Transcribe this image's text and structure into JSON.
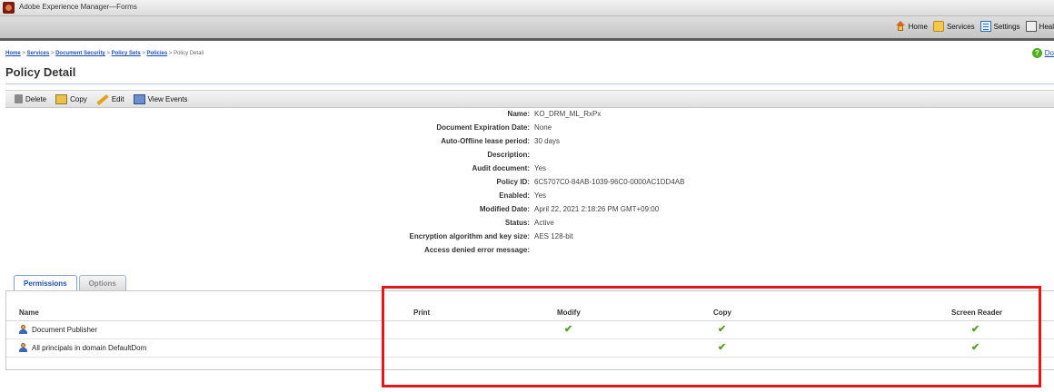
{
  "app": {
    "window_title": "Adobe Experience Manager—Forms"
  },
  "topnav": [
    {
      "label": "Home",
      "icon": "home-icon"
    },
    {
      "label": "Services",
      "icon": "services-icon"
    },
    {
      "label": "Settings",
      "icon": "settings-icon"
    },
    {
      "label": "Heal",
      "icon": "health-icon"
    }
  ],
  "breadcrumb": {
    "links": [
      "Home",
      "Services",
      "Document Security",
      "Policy Sets",
      "Policies"
    ],
    "separator": ">",
    "current": "Policy Detail"
  },
  "help": {
    "label": "Do",
    "icon": "help-icon"
  },
  "page": {
    "title": "Policy Detail"
  },
  "toolbar": {
    "delete": "Delete",
    "copy": "Copy",
    "edit": "Edit",
    "view_events": "View Events"
  },
  "details": [
    {
      "label": "Name:",
      "value": "KO_DRM_ML_RxPx"
    },
    {
      "label": "Document Expiration Date:",
      "value": "None"
    },
    {
      "label": "Auto-Offline lease period:",
      "value": "30 days"
    },
    {
      "label": "Description:",
      "value": ""
    },
    {
      "label": "Audit document:",
      "value": "Yes"
    },
    {
      "label": "Policy ID:",
      "value": "6C5707C0-84AB-1039-96C0-0000AC1DD4AB"
    },
    {
      "label": "Enabled:",
      "value": "Yes"
    },
    {
      "label": "Modified Date:",
      "value": "April 22, 2021 2:18:26 PM GMT+09:00"
    },
    {
      "label": "Status:",
      "value": "Active"
    },
    {
      "label": "Encryption algorithm and key size:",
      "value": "AES 128-bit"
    },
    {
      "label": "Access denied error message:",
      "value": ""
    }
  ],
  "tabs": [
    {
      "label": "Permissions",
      "active": true
    },
    {
      "label": "Options",
      "active": false
    }
  ],
  "permissions": {
    "columns": [
      "Name",
      "Print",
      "Modify",
      "Copy",
      "Screen Reader"
    ],
    "check_glyph": "✔",
    "rows": [
      {
        "name": "Document Publisher",
        "print": false,
        "modify": true,
        "copy": true,
        "screen_reader": true
      },
      {
        "name": "All principals in domain DefaultDom",
        "print": false,
        "modify": false,
        "copy": true,
        "screen_reader": true
      }
    ]
  },
  "colors": {
    "link": "#1f4fb0",
    "check": "#5a9a2b",
    "highlight": "#e01818"
  }
}
